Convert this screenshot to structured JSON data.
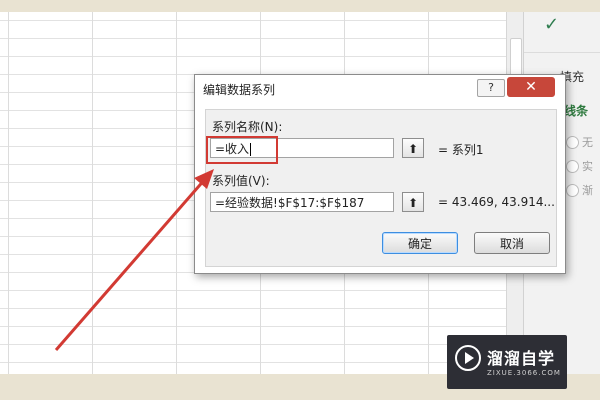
{
  "dialog": {
    "title": "编辑数据系列",
    "help_label": "?",
    "close_label": "✕",
    "series_name": {
      "label": "系列名称(N):",
      "value": "=收入",
      "preview": "= 系列1"
    },
    "series_values": {
      "label": "系列值(V):",
      "value": "=经验数据!$F$17:$F$187",
      "preview": "= 43.469, 43.914..."
    },
    "ok_label": "确定",
    "cancel_label": "取消"
  },
  "side_pane": {
    "fill_label": "填充",
    "line_label": "线条",
    "options": [
      "无",
      "实",
      "渐"
    ]
  },
  "watermark": {
    "name": "溜溜自学",
    "url": "ZIXUE.3066.COM"
  },
  "colors": {
    "highlight": "#d23a33",
    "close_button": "#c7473a",
    "accent_green": "#2e7a3f"
  }
}
